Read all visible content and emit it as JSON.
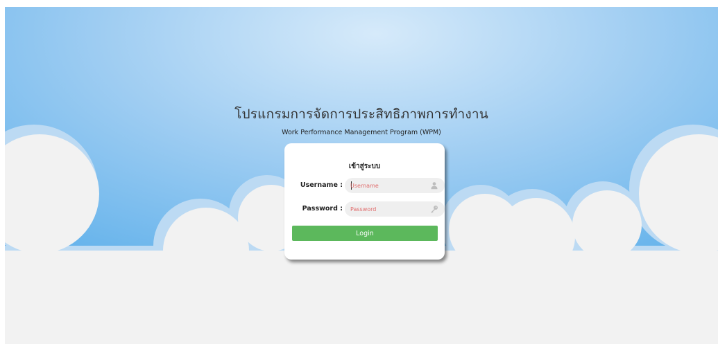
{
  "header": {
    "title_th": "โปรแกรมการจัดการประสิทธิภาพการทำงาน",
    "subtitle_en": "Work Performance Management Program (WPM)"
  },
  "login_card": {
    "title": "เข้าสู่ระบบ",
    "username_label": "Username :",
    "username_placeholder": "Username",
    "username_value": "",
    "username_icon": "user-icon",
    "password_label": "Password :",
    "password_placeholder": "Password",
    "password_value": "",
    "password_icon": "key-icon",
    "login_button_label": "Login"
  },
  "colors": {
    "sky_light": "#cfe5f8",
    "sky_dark": "#5eb0eb",
    "cloud": "#f2f2f2",
    "cloud_edge": "#bcdaf3",
    "login_button": "#5cb85c",
    "placeholder": "#e06b6b"
  }
}
